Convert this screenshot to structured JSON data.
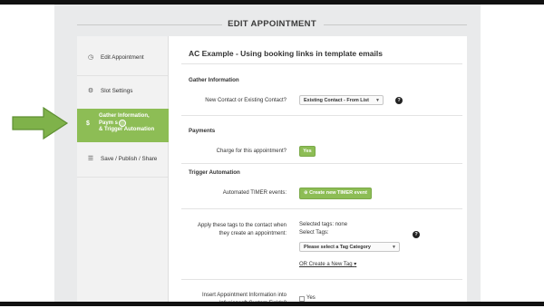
{
  "header": {
    "title": "EDIT APPOINTMENT"
  },
  "sidebar": {
    "items": [
      {
        "label": "Edit Appointment",
        "icon": "clock-icon"
      },
      {
        "label": "Slot Settings",
        "icon": "gear-icon"
      },
      {
        "label": "Save / Publish / Share",
        "icon": "list-icon"
      }
    ],
    "active": {
      "line1": "Gather Information,",
      "line2": "Paym  s",
      "line3": "& Trigger Automation",
      "icon": "dollar-icon"
    }
  },
  "main": {
    "title": "AC Example - Using booking links in template emails",
    "sections": {
      "gather": "Gather Information",
      "payments": "Payments",
      "trigger": "Trigger Automation"
    },
    "contact_label": "New Contact or Existing Contact?",
    "contact_select": "Existing Contact - From List",
    "charge_label": "Charge for this appointment?",
    "charge_button": "Yes",
    "timer_label": "Automated TIMER events:",
    "timer_button": "Create new TIMER event",
    "tags_label_line1": "Apply these tags to the contact when",
    "tags_label_line2": "they create an appointment:",
    "selected_tags": "Selected tags: none",
    "select_tags_label": "Select Tags:",
    "tag_category_select": "Please select a Tag Category",
    "create_tag_link": "OR Create a New Tag",
    "insert_label_line1": "Insert Appointment Information into",
    "insert_label_line2": "Infusionsoft Custom Fields?",
    "insert_checkbox_label": "Yes"
  },
  "colors": {
    "accent": "#8dbd55",
    "arrow": "#7fb24a"
  }
}
